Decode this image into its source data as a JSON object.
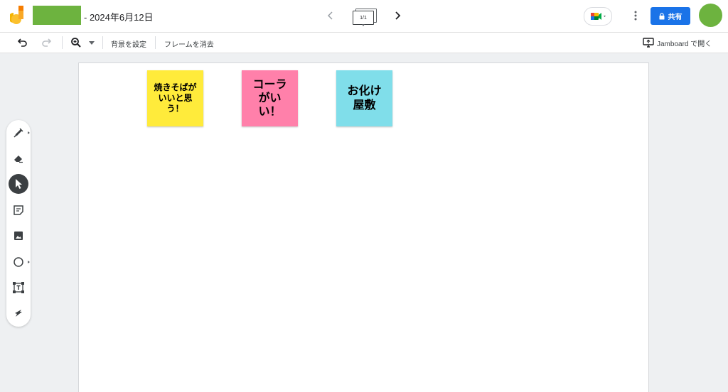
{
  "header": {
    "title": "- 2024年6月12日",
    "frame_counter": "1/1",
    "share_label": "共有",
    "icons": {
      "logo": "jamboard-logo",
      "prev": "chevron-left-icon",
      "next": "chevron-right-icon",
      "meet": "google-meet-icon",
      "more": "more-vert-icon",
      "share": "lock-icon"
    },
    "colors": {
      "title_block": "#6db33f",
      "avatar": "#6db33f",
      "share_bg": "#1a73e8"
    }
  },
  "toolbar": {
    "set_background": "背景を設定",
    "clear_frame": "フレームを消去",
    "open_in_jamboard": "Jamboard で開く",
    "icons": [
      "undo-icon",
      "redo-icon",
      "zoom-icon",
      "chevron-down-icon",
      "open-in-jamboard-icon"
    ]
  },
  "canvas": {
    "notes": [
      {
        "text": "焼きそばが\nいいと思\nう！",
        "color": "#ffeb3b"
      },
      {
        "text": "コーラ\nがい\nい！",
        "color": "#ff80aa"
      },
      {
        "text": "お化け\n屋敷",
        "color": "#80deea"
      }
    ]
  },
  "side_tools": {
    "items": [
      {
        "name": "pen",
        "icon": "pen-icon",
        "has_submenu": true
      },
      {
        "name": "eraser",
        "icon": "eraser-icon",
        "has_submenu": false
      },
      {
        "name": "select",
        "icon": "cursor-icon",
        "active": true
      },
      {
        "name": "sticky-note",
        "icon": "sticky-note-icon",
        "has_submenu": false
      },
      {
        "name": "image",
        "icon": "image-icon",
        "has_submenu": false
      },
      {
        "name": "circle",
        "icon": "circle-icon",
        "has_submenu": true
      },
      {
        "name": "text-box",
        "icon": "text-box-icon",
        "has_submenu": false
      },
      {
        "name": "laser",
        "icon": "laser-icon",
        "has_submenu": false
      }
    ]
  }
}
